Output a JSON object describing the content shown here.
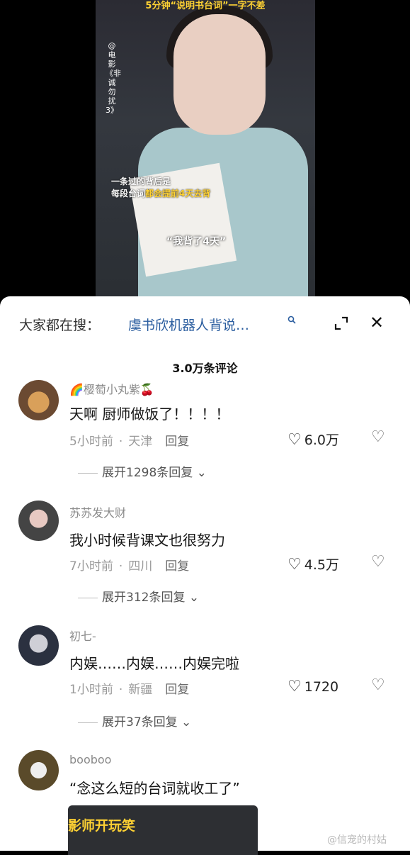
{
  "video": {
    "top_caption": "5分钟“说明书台词”一字不差",
    "credit": "@电影《非诚勿扰3》",
    "caption_line1": "一条过的背后是",
    "caption_line2_prefix": "每段台词",
    "caption_line2_highlight": "都会提前4天去背",
    "quote": "“我背了4天”"
  },
  "search": {
    "label": "大家都在搜：",
    "query": "虞书欣机器人背说…",
    "icon": "search-icon"
  },
  "comments_count": "3.0万条评论",
  "comments": [
    {
      "username": "🌈樱萄小丸紫🍒",
      "text": "天啊 厨师做饭了！！！！",
      "time": "5小时前",
      "location": "天津",
      "reply": "回复",
      "likes": "6.0万",
      "expand": "展开1298条回复"
    },
    {
      "username": "苏苏发大财",
      "text": "我小时候背课文也很努力",
      "time": "7小时前",
      "location": "四川",
      "reply": "回复",
      "likes": "4.5万",
      "expand": "展开312条回复"
    },
    {
      "username": "初七-",
      "text": "内娱……内娱……内娱完啦",
      "time": "1小时前",
      "location": "新疆",
      "reply": "回复",
      "likes": "1720",
      "expand": "展开37条回复"
    },
    {
      "username": "booboo",
      "text": "“念这么短的台词就收工了”"
    }
  ],
  "thumb_text": "影师开玩笑",
  "watermark": "@信宠的村姑"
}
